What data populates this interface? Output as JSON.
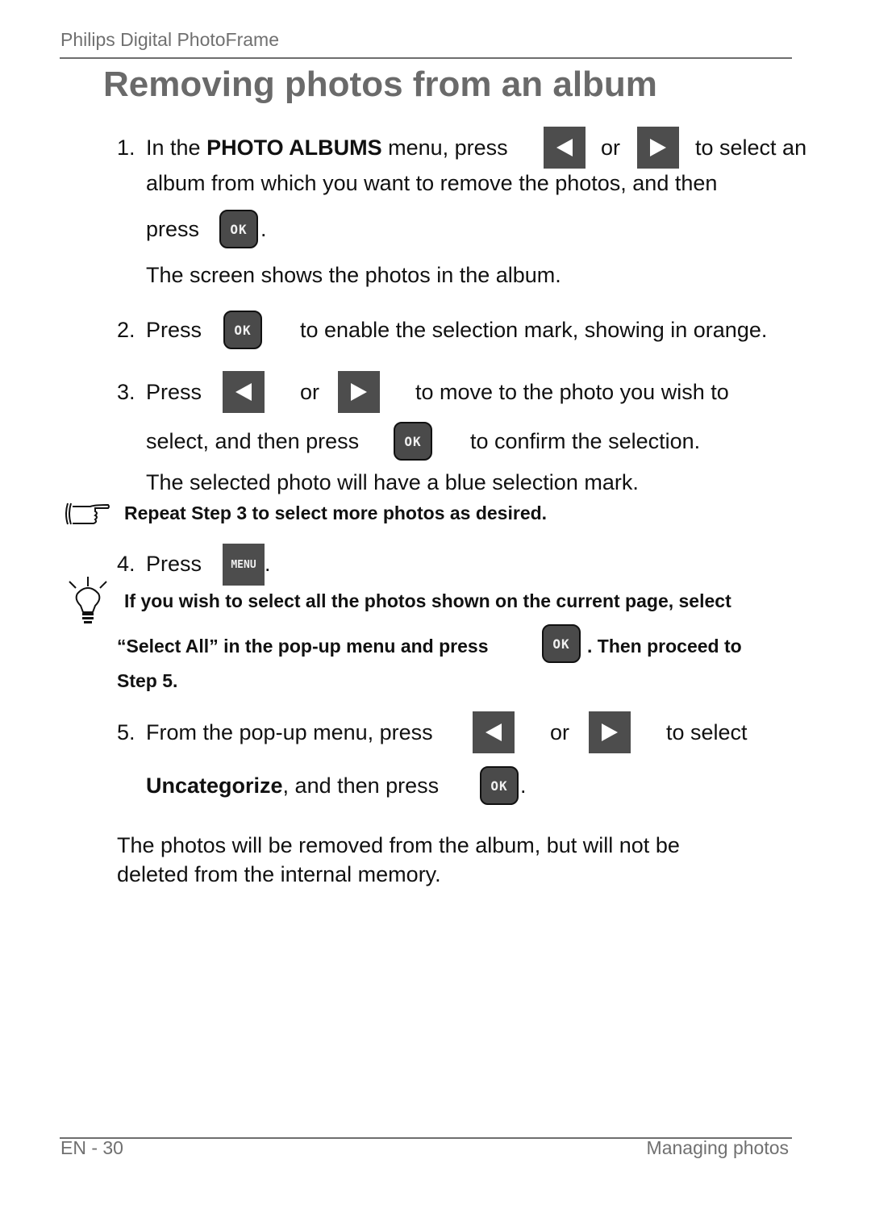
{
  "header": {
    "product": "Philips Digital PhotoFrame"
  },
  "title": "Removing photos from an album",
  "steps": {
    "s1": {
      "num": "1.",
      "pre": "In the",
      "menu_name": "PHOTO ALBUMS",
      "mid": "menu, press",
      "or": "or",
      "post": "to select an",
      "line2": "album from which you want to remove the photos, and then",
      "line3_pre": "press",
      "line3_post": ".",
      "result": "The screen shows the photos in the album."
    },
    "s2": {
      "num": "2.",
      "pre": "Press",
      "post": "to enable the selection mark, showing in orange."
    },
    "s3": {
      "num": "3.",
      "pre": "Press",
      "or": "or",
      "post": "to move to the photo you wish to",
      "line2_pre": "select, and then press",
      "line2_post": "to confirm the selection.",
      "result": "The selected photo will have a blue selection mark."
    },
    "s4": {
      "num": "4.",
      "pre": "Press",
      "post": "."
    },
    "s5": {
      "num": "5.",
      "pre": "From the pop-up menu, press",
      "or": "or",
      "post": "to select",
      "option": "Uncategorize",
      "line2_mid": ", and then press",
      "line2_post": "."
    }
  },
  "notes": {
    "pointer_note": "Repeat Step 3 to select more photos as desired.",
    "tip_line1": "If you wish to select all the photos shown on the current page, select",
    "tip_line2_pre": "“Select All” in the pop-up menu and press",
    "tip_line2_post": ". Then proceed to",
    "tip_line3": "Step 5."
  },
  "conclusion": {
    "line1": "The photos will be removed from the album, but will not be",
    "line2": "deleted from the internal memory."
  },
  "keys": {
    "ok": "OK",
    "menu": "MENU",
    "left": "left-arrow",
    "right": "right-arrow"
  },
  "footer": {
    "page": "EN - 30",
    "section": "Managing photos"
  }
}
